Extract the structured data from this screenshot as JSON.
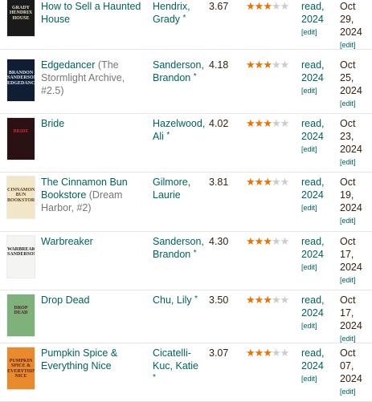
{
  "books": [
    {
      "title": "How to Sell a Haunted House",
      "series": "",
      "author": "Hendrix, Grady",
      "author_star": "*",
      "avg_rating": "3.67",
      "stars_filled": 3,
      "shelf": "read, 2024",
      "shelf_edit": "[edit]",
      "date_read": "Oct 29, 2024",
      "date_edit": "[edit]",
      "cover": {
        "bg": "#1a1a1a",
        "fg": "#e8e0c8",
        "text": "GRADY HENDRIX HOUSE"
      }
    },
    {
      "title": "Edgedancer",
      "series": "(The Stormlight Archive, #2.5)",
      "author": "Sanderson, Brandon",
      "author_star": "*",
      "avg_rating": "4.18",
      "stars_filled": 3,
      "shelf": "read, 2024",
      "shelf_edit": "[edit]",
      "date_read": "Oct 25, 2024",
      "date_edit": "[edit]",
      "cover": {
        "bg": "#0f1e33",
        "fg": "#dfe6ef",
        "text": "BRANDON SANDERSON EDGEDANCER"
      }
    },
    {
      "title": "Bride",
      "series": "",
      "author": "Hazelwood, Ali",
      "author_star": "*",
      "avg_rating": "4.02",
      "stars_filled": 3,
      "shelf": "read, 2024",
      "shelf_edit": "[edit]",
      "date_read": "Oct 23, 2024",
      "date_edit": "[edit]",
      "cover": {
        "bg": "#2a1214",
        "fg": "#c92a32",
        "text": "BRIDE"
      }
    },
    {
      "title": "The Cinnamon Bun Bookstore",
      "series": "(Dream Harbor, #2)",
      "author": "Gilmore, Laurie",
      "author_star": "",
      "avg_rating": "3.81",
      "stars_filled": 3,
      "shelf": "read, 2024",
      "shelf_edit": "[edit]",
      "date_read": "Oct 19, 2024",
      "date_edit": "[edit]",
      "cover": {
        "bg": "#f2e6c9",
        "fg": "#5a3e1e",
        "text": "CINNAMON BUN BOOKSTORE"
      }
    },
    {
      "title": "Warbreaker",
      "series": "",
      "author": "Sanderson, Brandon",
      "author_star": "*",
      "avg_rating": "4.30",
      "stars_filled": 3,
      "shelf": "read, 2024",
      "shelf_edit": "[edit]",
      "date_read": "Oct 17, 2024",
      "date_edit": "[edit]",
      "cover": {
        "bg": "#f4f4f2",
        "fg": "#222222",
        "text": "WARBREAKER SANDERSON"
      }
    },
    {
      "title": "Drop Dead",
      "series": "",
      "author": "Chu, Lily",
      "author_star": "*",
      "avg_rating": "3.50",
      "stars_filled": 3,
      "shelf": "read, 2024",
      "shelf_edit": "[edit]",
      "date_read": "Oct 17, 2024",
      "date_edit": "[edit]",
      "cover": {
        "bg": "#7fb27a",
        "fg": "#4a1d2a",
        "text": "DROP DEAD"
      }
    },
    {
      "title": "Pumpkin Spice & Everything Nice",
      "series": "",
      "author": "Cicatelli-Kuc, Katie",
      "author_star": "*",
      "avg_rating": "3.07",
      "stars_filled": 3,
      "shelf": "read, 2024",
      "shelf_edit": "[edit]",
      "date_read": "Oct 07, 2024",
      "date_edit": "[edit]",
      "cover": {
        "bg": "#e98b2c",
        "fg": "#5a1d0e",
        "text": "PUMPKIN SPICE & EVERYTHING NICE"
      }
    }
  ],
  "colors": {
    "link": "#00635d",
    "text": "#382110",
    "star_filled": "#e87400",
    "star_empty": "#cccccc",
    "divider": "#e8e6e2"
  },
  "icons": {
    "star": "star-icon"
  }
}
